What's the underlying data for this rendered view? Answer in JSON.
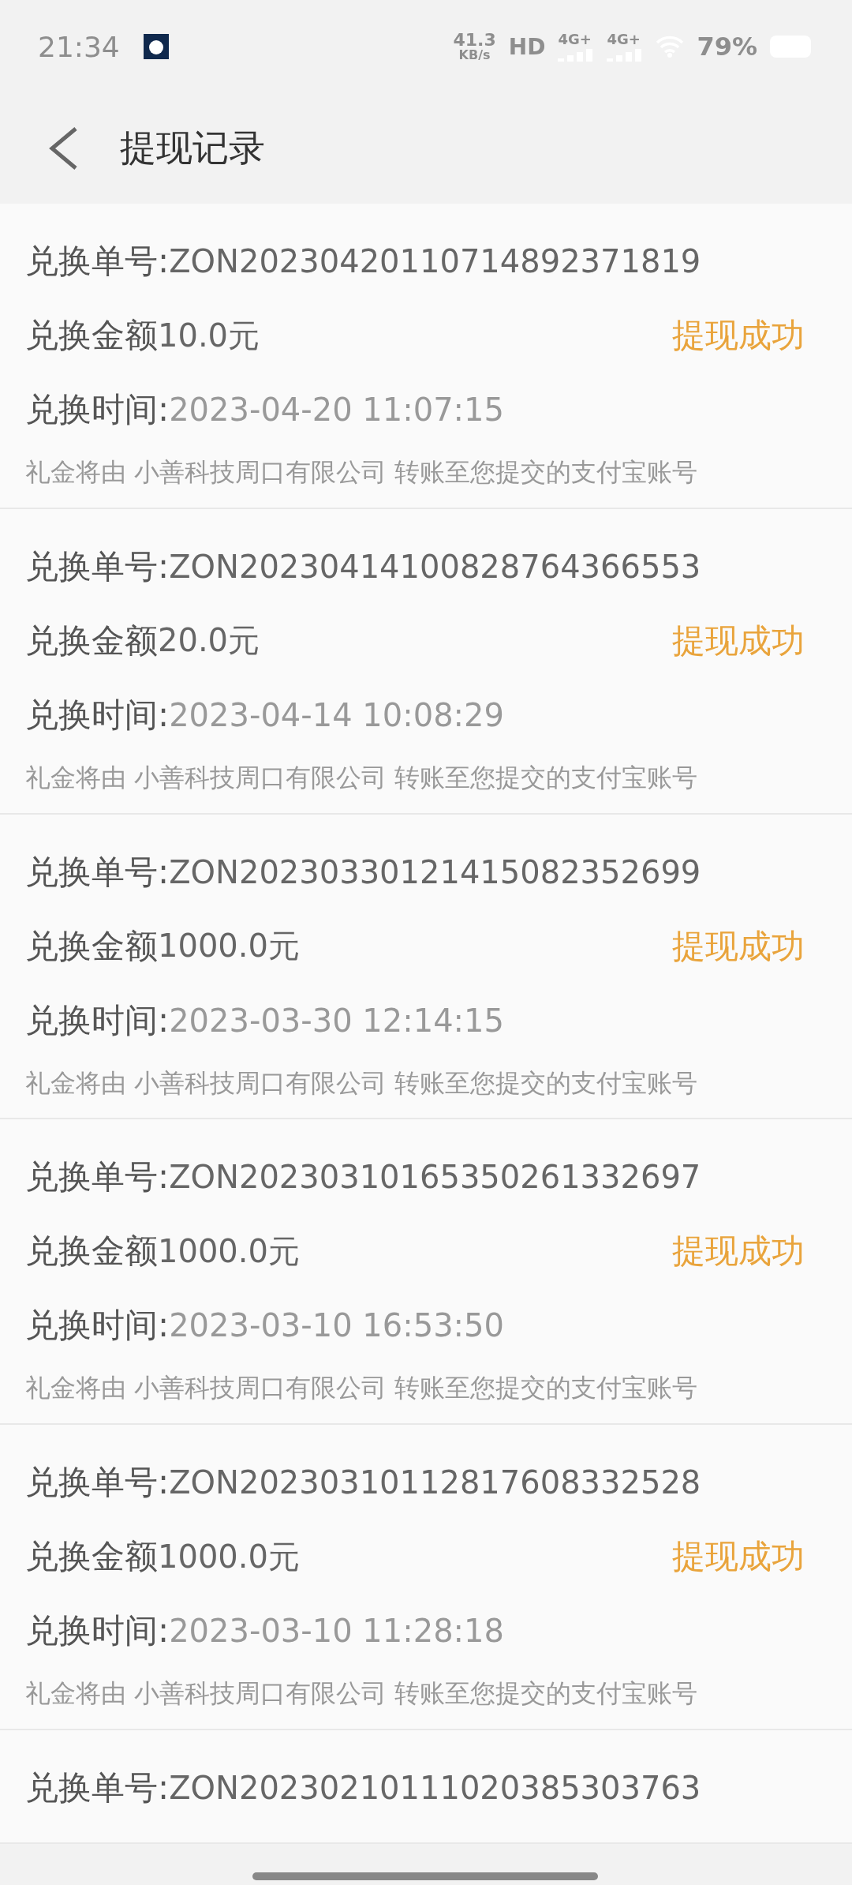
{
  "status_bar": {
    "time": "21:34",
    "speed_value": "41.3",
    "speed_unit": "KB/s",
    "hd": "HD",
    "networks": [
      "4G+",
      "4G+"
    ],
    "battery": "79%"
  },
  "header": {
    "title": "提现记录"
  },
  "records": [
    {
      "order_label": "兑换单号:",
      "order_no": "ZON20230420110714892371819",
      "amount_label": "兑换金额",
      "amount": "10.0元",
      "status": "提现成功",
      "time_label": "兑换时间:",
      "time": "2023-04-20 11:07:15",
      "note": "礼金将由 小善科技周口有限公司 转账至您提交的支付宝账号"
    },
    {
      "order_label": "兑换单号:",
      "order_no": "ZON20230414100828764366553",
      "amount_label": "兑换金额",
      "amount": "20.0元",
      "status": "提现成功",
      "time_label": "兑换时间:",
      "time": "2023-04-14 10:08:29",
      "note": "礼金将由 小善科技周口有限公司 转账至您提交的支付宝账号"
    },
    {
      "order_label": "兑换单号:",
      "order_no": "ZON20230330121415082352699",
      "amount_label": "兑换金额",
      "amount": "1000.0元",
      "status": "提现成功",
      "time_label": "兑换时间:",
      "time": "2023-03-30 12:14:15",
      "note": "礼金将由 小善科技周口有限公司 转账至您提交的支付宝账号"
    },
    {
      "order_label": "兑换单号:",
      "order_no": "ZON20230310165350261332697",
      "amount_label": "兑换金额",
      "amount": "1000.0元",
      "status": "提现成功",
      "time_label": "兑换时间:",
      "time": "2023-03-10 16:53:50",
      "note": "礼金将由 小善科技周口有限公司 转账至您提交的支付宝账号"
    },
    {
      "order_label": "兑换单号:",
      "order_no": "ZON20230310112817608332528",
      "amount_label": "兑换金额",
      "amount": "1000.0元",
      "status": "提现成功",
      "time_label": "兑换时间:",
      "time": "2023-03-10 11:28:18",
      "note": "礼金将由 小善科技周口有限公司 转账至您提交的支付宝账号"
    },
    {
      "order_label": "兑换单号:",
      "order_no": "ZON20230210111020385303763"
    }
  ]
}
